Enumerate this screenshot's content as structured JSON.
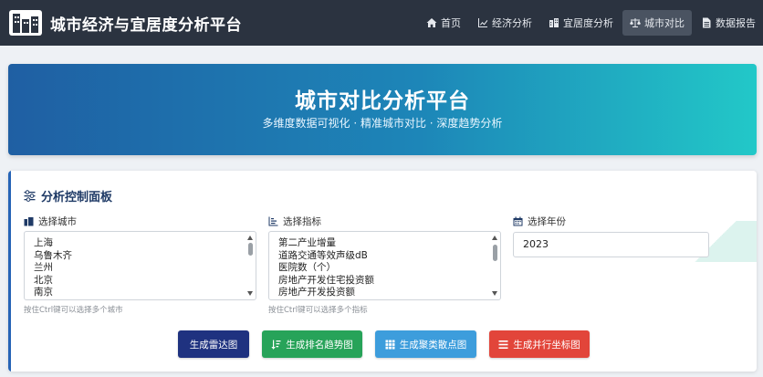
{
  "app": {
    "title": "城市经济与宜居度分析平台"
  },
  "nav": {
    "items": [
      {
        "label": "首页",
        "icon": "home-icon"
      },
      {
        "label": "经济分析",
        "icon": "line-chart-icon"
      },
      {
        "label": "宜居度分析",
        "icon": "building-icon"
      },
      {
        "label": "城市对比",
        "icon": "balance-scale-icon",
        "active": true
      },
      {
        "label": "数据报告",
        "icon": "file-icon"
      }
    ]
  },
  "hero": {
    "title": "城市对比分析平台",
    "subtitle": "多维度数据可视化 · 精准城市对比 · 深度趋势分析"
  },
  "panel": {
    "title": "分析控制面板",
    "city": {
      "label": "选择城市",
      "options": [
        "上海",
        "乌鲁木齐",
        "兰州",
        "北京",
        "南京"
      ],
      "hint": "按住Ctrl键可以选择多个城市"
    },
    "indicator": {
      "label": "选择指标",
      "options": [
        "第二产业增量",
        "道路交通等效声级dB",
        "医院数（个）",
        "房地产开发住宅投资额",
        "房地产开发投资额"
      ],
      "hint": "按住Ctrl键可以选择多个指标"
    },
    "year": {
      "label": "选择年份",
      "value": "2023"
    },
    "buttons": {
      "radar": "生成雷达图",
      "ranking": "生成排名趋势图",
      "cluster": "生成聚类散点图",
      "parallel": "生成并行坐标图"
    }
  },
  "colors": {
    "navbar": "#2b3340",
    "accent": "#1f3a66",
    "btn_radar": "#1f3280",
    "btn_ranking": "#27a359",
    "btn_cluster": "#3d9ddc",
    "btn_parallel": "#e2453a"
  }
}
